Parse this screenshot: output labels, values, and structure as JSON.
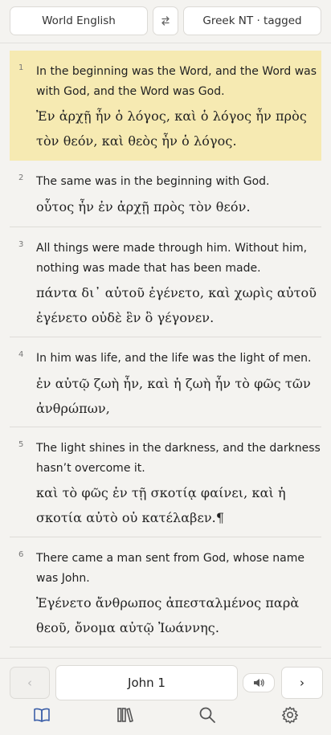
{
  "header": {
    "left_version": "World English",
    "swap_icon": "swap-icon",
    "right_version": "Greek NT · tagged"
  },
  "verses": [
    {
      "num": "1",
      "en": [
        "In the beginning was the Word, and the Word was",
        "with God, and the Word was God."
      ],
      "gr": [
        "Ἐν ἀρχῇ ἦν ὁ λόγος, καὶ ὁ λόγος ἦν πρὸς",
        "τὸν θεόν, καὶ θεὸς ἦν ὁ λόγος."
      ],
      "highlighted": true
    },
    {
      "num": "2",
      "en": [
        "The same was in the beginning with God."
      ],
      "gr": [
        "οὗτος ἦν ἐν ἀρχῇ πρὸς τὸν θεόν."
      ]
    },
    {
      "num": "3",
      "en": [
        "All things were made through him. Without him,",
        "nothing was made that has been made."
      ],
      "gr": [
        "πάντα δι᾽ αὐτοῦ ἐγένετο, καὶ χωρὶς αὐτοῦ",
        "ἐγένετο οὐδὲ ἓν ὃ γέγονεν."
      ]
    },
    {
      "num": "4",
      "en": [
        "In him was life, and the life was the light of men."
      ],
      "gr": [
        "ἐν αὐτῷ ζωὴ ἦν, καὶ ἡ ζωὴ ἦν τὸ φῶς τῶν",
        "ἀνθρώπων,"
      ]
    },
    {
      "num": "5",
      "en": [
        "The light shines in the darkness, and the darkness",
        "hasn’t overcome it."
      ],
      "gr": [
        "καὶ τὸ φῶς ἐν τῇ σκοτίᾳ φαίνει, καὶ ἡ",
        "σκοτία αὐτὸ οὐ κατέλαβεν.¶"
      ]
    },
    {
      "num": "6",
      "en": [
        "There came a man sent from God, whose name",
        "was John."
      ],
      "gr": [
        "Ἐγένετο ἄνθρωπος ἀπεσταλμένος παρὰ",
        "θεοῦ, ὄνομα αὐτῷ Ἰωάννης."
      ]
    }
  ],
  "footer": {
    "prev_label": "‹",
    "chapter_label": "John 1",
    "audio_icon": "speaker-icon",
    "next_label": "›"
  },
  "nav": [
    {
      "name": "book-icon",
      "active": true
    },
    {
      "name": "library-icon",
      "active": false
    },
    {
      "name": "search-icon",
      "active": false
    },
    {
      "name": "gear-icon",
      "active": false
    }
  ],
  "colors": {
    "highlight": "#f6eab2",
    "accent": "#3c5fa8",
    "background": "#f4f3f0"
  }
}
